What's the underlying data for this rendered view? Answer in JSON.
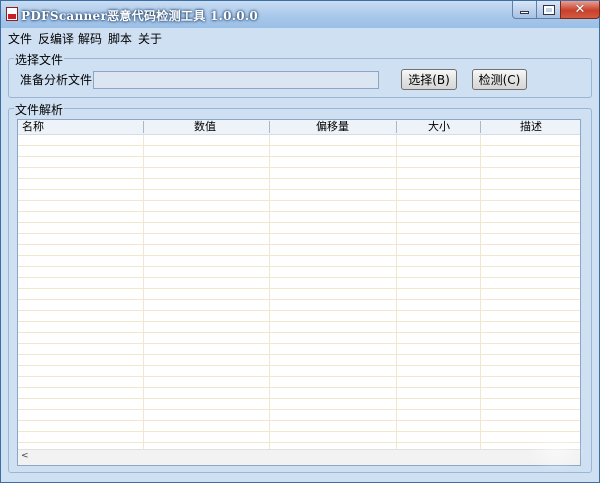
{
  "window": {
    "title": "PDFScanner恶意代码检测工具 1.0.0.0",
    "close_symbol": "✕"
  },
  "menu": [
    "文件",
    "反编译",
    "解码",
    "脚本",
    "关于"
  ],
  "select_group": {
    "legend": "选择文件",
    "file_label": "准备分析文件:",
    "file_value": "",
    "select_button": "选择(B)",
    "detect_button": "检测(C)"
  },
  "parse_group": {
    "legend": "文件解析",
    "columns": [
      "名称",
      "数值",
      "偏移量",
      "大小",
      "描述"
    ]
  },
  "scrollbar": {
    "left_arrow": "<"
  },
  "colors": {
    "window_bg": "#cfe0f3",
    "border": "#3a6ea5",
    "close_red": "#c8402c",
    "row_line": "#efe7cf"
  }
}
